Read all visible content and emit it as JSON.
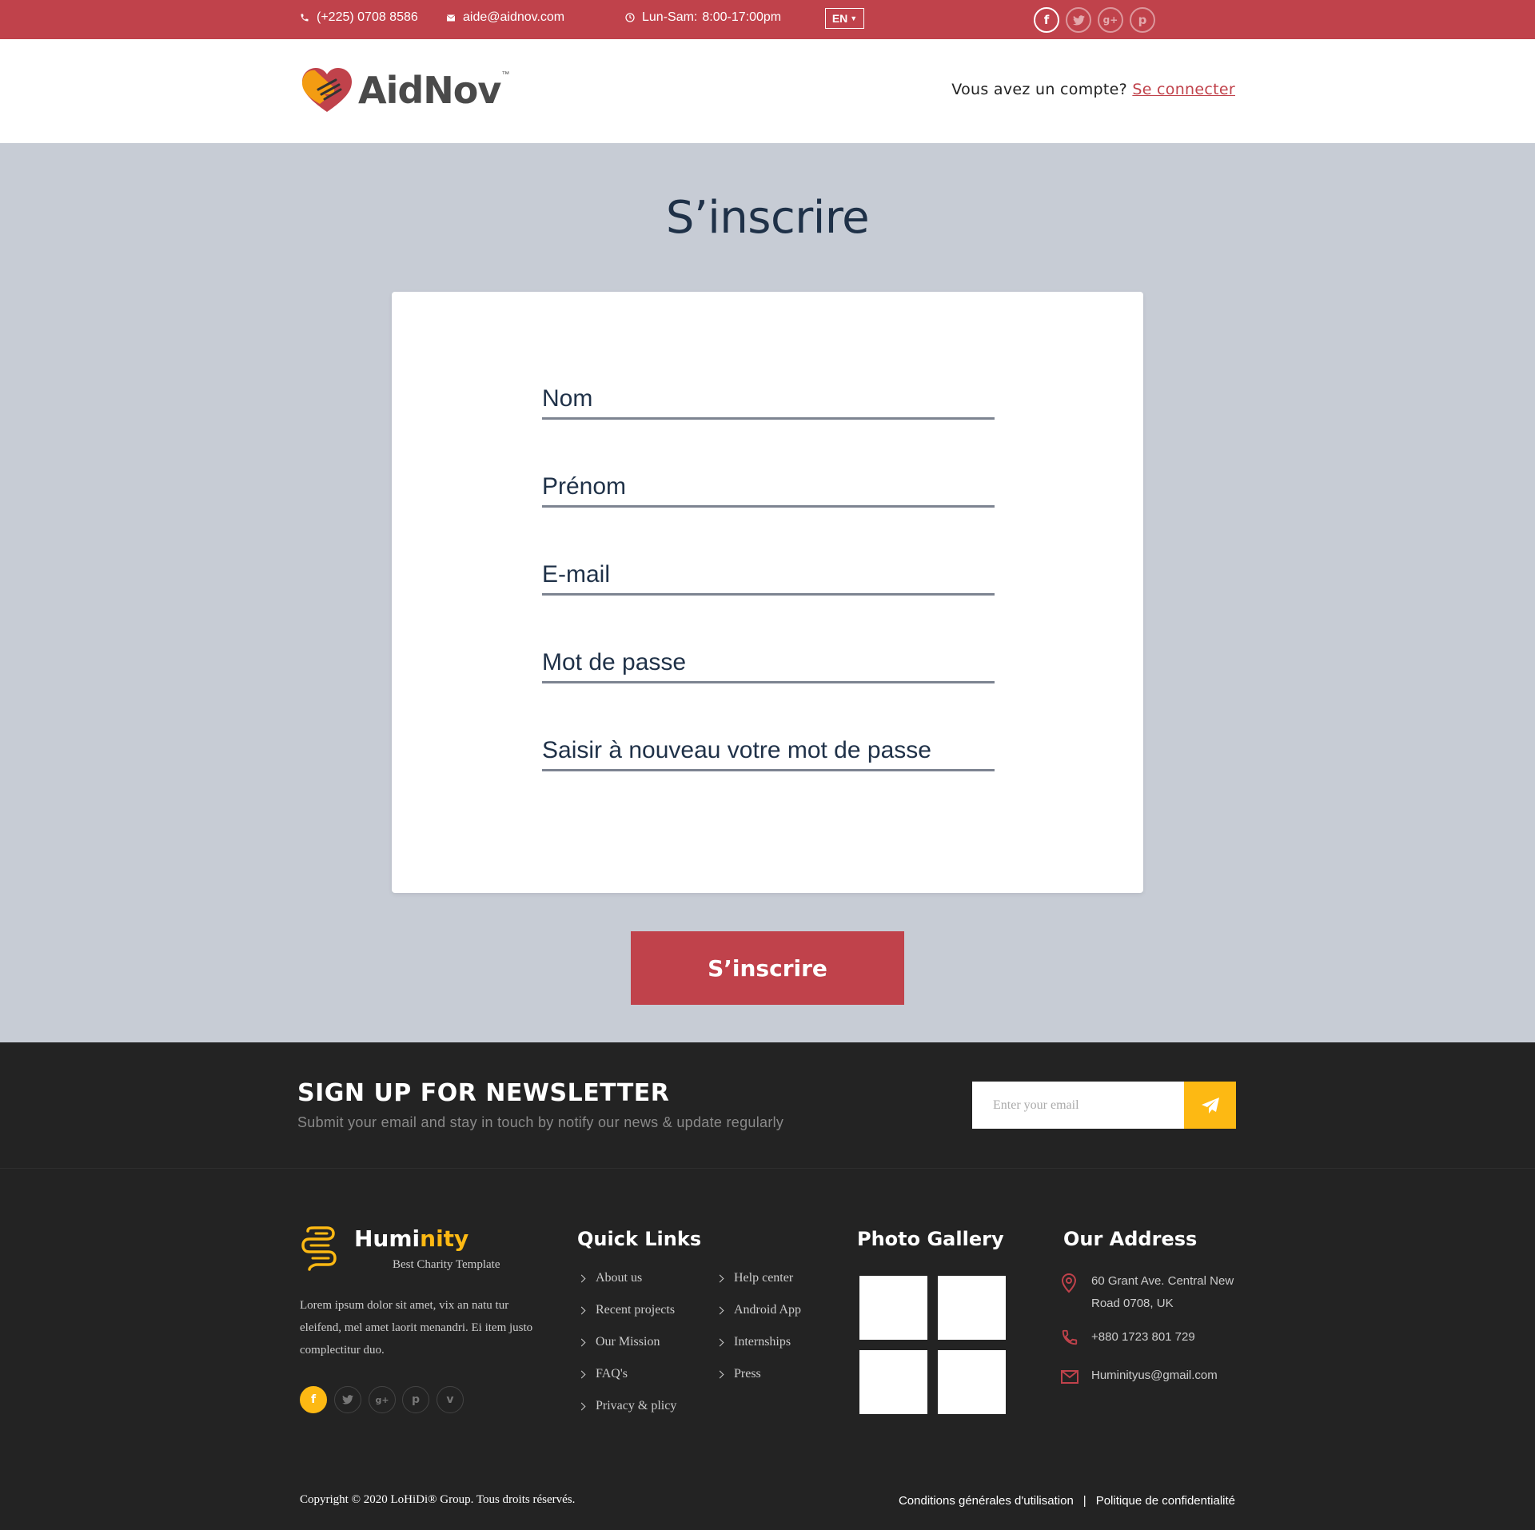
{
  "topbar": {
    "phone": "(+225) 0708 8586",
    "email": "aide@aidnov.com",
    "hours_label": "Lun-Sam:",
    "hours_value": "8:00-17:00pm",
    "language": "EN",
    "social": [
      "facebook-icon",
      "twitter-icon",
      "google-plus-icon",
      "pinterest-icon"
    ]
  },
  "header": {
    "logo_text": "AidNov",
    "logo_tm": "™",
    "account_prompt": "Vous avez un compte?",
    "login_link": "Se connecter"
  },
  "form": {
    "title": "S’inscrire",
    "fields": [
      {
        "placeholder": "Nom",
        "value": ""
      },
      {
        "placeholder": "Prénom",
        "value": ""
      },
      {
        "placeholder": "E-mail",
        "value": ""
      },
      {
        "placeholder": "Mot de passe",
        "value": ""
      },
      {
        "placeholder": "Saisir à nouveau votre mot de passe",
        "value": ""
      }
    ],
    "submit_label": "S’inscrire"
  },
  "newsletter": {
    "title": "SIGN UP FOR NEWSLETTER",
    "subtitle": "Submit your email and stay in touch by notify our news & update regularly",
    "input_placeholder": "Enter your email"
  },
  "footer": {
    "brand_name_a": "Humi",
    "brand_name_b": "nity",
    "brand_tagline": "Best Charity Template",
    "about": "Lorem ipsum dolor sit amet, vix an natu tur eleifend, mel amet laorit menandri. Ei item justo complectitur duo.",
    "social": [
      "facebook-icon",
      "twitter-icon",
      "google-plus-icon",
      "pinterest-icon",
      "vimeo-icon"
    ],
    "quick_links_title": "Quick Links",
    "quick_links_col1": [
      "About us",
      "Recent projects",
      "Our Mission",
      "FAQ's",
      "Privacy & plicy"
    ],
    "quick_links_col2": [
      "Help center",
      "Android App",
      "Internships",
      "Press"
    ],
    "gallery_title": "Photo Gallery",
    "address_title": "Our Address",
    "address": "60 Grant Ave. Central New Road 0708, UK",
    "phone": "+880 1723 801 729",
    "email": "Huminityus@gmail.com",
    "copyright": "Copyright © 2020 LoHiDi® Group. Tous droits réservés.",
    "terms": "Conditions générales d'utilisation",
    "separator": "|",
    "privacy": "Politique de confidentialité"
  },
  "colors": {
    "brand_red": "#c0424b",
    "accent_yellow": "#fdb913",
    "page_bg": "#c7ccd5",
    "footer_bg": "#232323"
  }
}
